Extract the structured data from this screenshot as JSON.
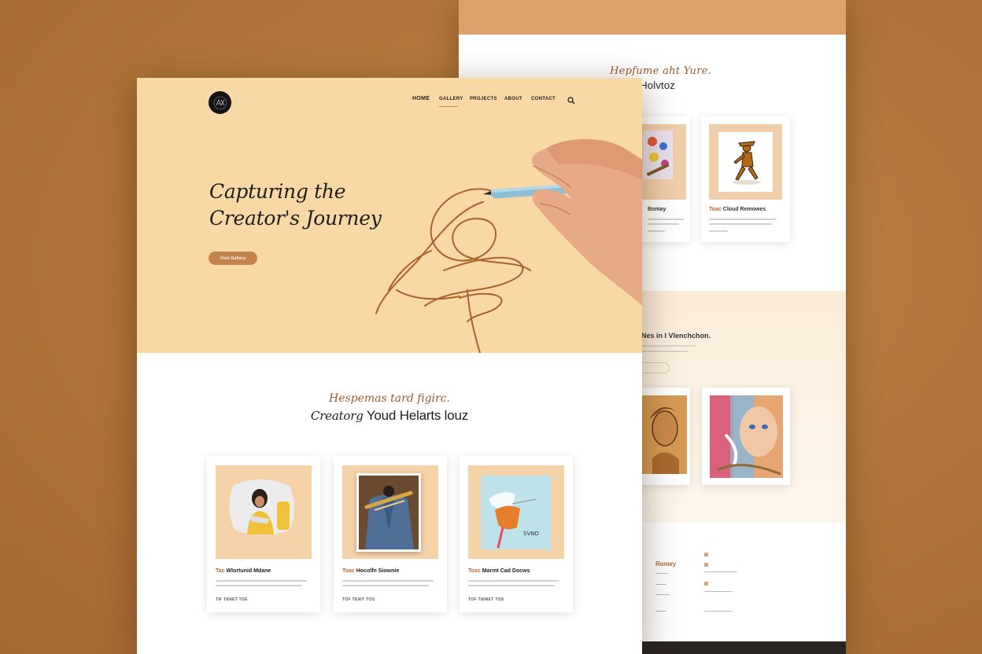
{
  "colors": {
    "background": "#b57a40",
    "hero_bg": "#f8d9a6",
    "accent": "#c2834e",
    "card_frame": "#f6d2a9",
    "back_topbar": "#dda16c"
  },
  "back_page": {
    "script_text": "Hepfume aht Yure.",
    "heading": "torbore/ Holvtoz",
    "cards": [
      {
        "caption_accent": "",
        "caption": "Bomay"
      },
      {
        "caption_accent": "Toac",
        "caption": "Cloud Remowes"
      }
    ],
    "section2_title": "Nes in I Vlenchchon.",
    "footer_title": "Ronwy"
  },
  "header": {
    "logo_text": "ANVD",
    "nav": [
      "HOME",
      "GALLERY",
      "PROJECTS",
      "ABOUT",
      "CONTACT"
    ]
  },
  "hero": {
    "title_line1": "Capturing the",
    "title_line2": "Creator's Journey",
    "button_label": "Visit Gallery"
  },
  "section": {
    "script_text": "Hespemas tard figirc.",
    "heading_italic": "Creatorg",
    "heading": "Youd Helarts louz"
  },
  "cards": [
    {
      "caption_accent": "Tac",
      "caption": "Wlortunid Mdane",
      "meta": "TIF TENET TOE",
      "icon": "woman-portrait-image"
    },
    {
      "caption_accent": "Toac",
      "caption": "Hocolfn Siownie",
      "meta": "TOF TENIT TOS",
      "icon": "denim-jacket-image"
    },
    {
      "caption_accent": "Tosc",
      "caption": "Marmt Cad Docws",
      "meta": "TOF TIEMET TOS",
      "icon": "paint-pour-image"
    }
  ]
}
